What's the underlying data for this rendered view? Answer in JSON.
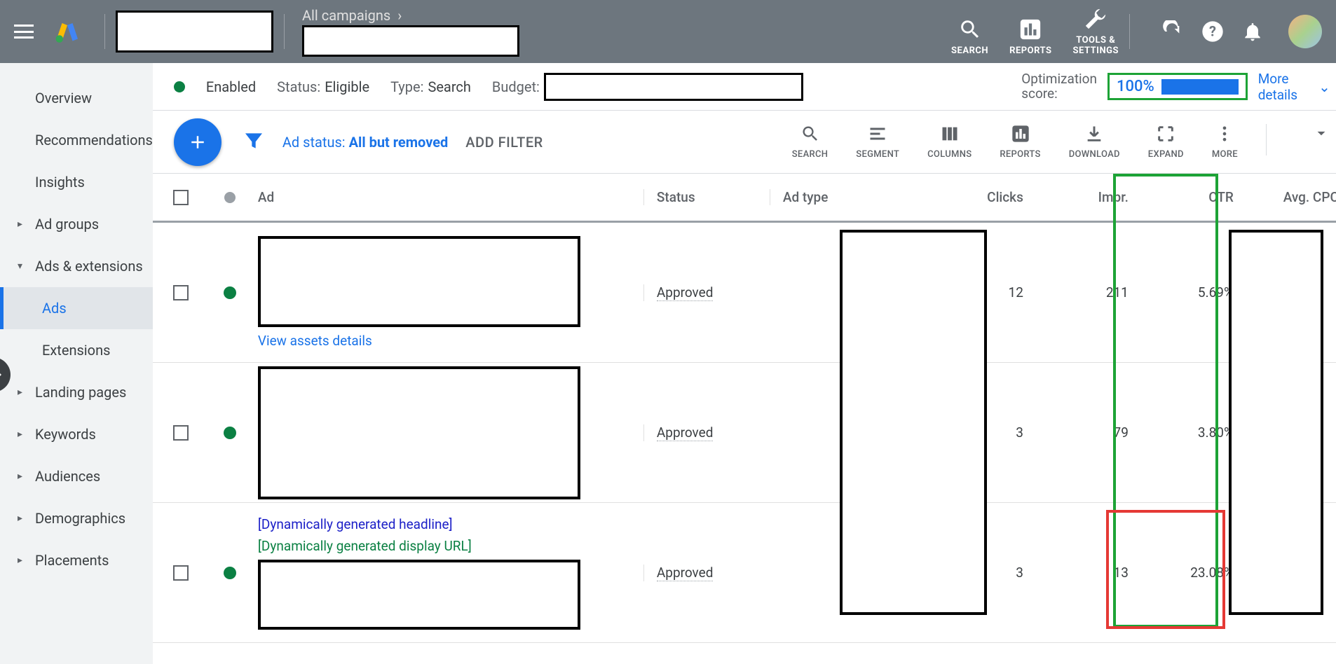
{
  "topbar": {
    "breadcrumb": "All campaigns",
    "tools": {
      "search": "SEARCH",
      "reports": "REPORTS",
      "settings": "TOOLS &\nSETTINGS"
    }
  },
  "sidebar": {
    "items": [
      {
        "label": "Overview",
        "type": "plain"
      },
      {
        "label": "Recommendations",
        "type": "plain"
      },
      {
        "label": "Insights",
        "type": "plain"
      },
      {
        "label": "Ad groups",
        "type": "expandable"
      },
      {
        "label": "Ads & extensions",
        "type": "expanded"
      },
      {
        "label": "Ads",
        "type": "sub",
        "active": true
      },
      {
        "label": "Extensions",
        "type": "sub"
      },
      {
        "label": "Landing pages",
        "type": "expandable"
      },
      {
        "label": "Keywords",
        "type": "expandable"
      },
      {
        "label": "Audiences",
        "type": "expandable"
      },
      {
        "label": "Demographics",
        "type": "expandable"
      },
      {
        "label": "Placements",
        "type": "expandable"
      }
    ]
  },
  "summary": {
    "enabled": "Enabled",
    "status_l": "Status:",
    "status_v": "Eligible",
    "type_l": "Type:",
    "type_v": "Search",
    "budget_l": "Budget:",
    "opt_l": "Optimization\nscore:",
    "opt_v": "100%",
    "more": "More\ndetails"
  },
  "toolbar": {
    "chip_k": "Ad status: ",
    "chip_v": "All but removed",
    "addfilter": "ADD FILTER",
    "mini": [
      "SEARCH",
      "SEGMENT",
      "COLUMNS",
      "REPORTS",
      "DOWNLOAD",
      "EXPAND",
      "MORE"
    ]
  },
  "table": {
    "headers": {
      "ad": "Ad",
      "status": "Status",
      "type": "Ad type",
      "clicks": "Clicks",
      "impr": "Impr.",
      "ctr": "CTR",
      "cpc": "Avg. CPC"
    },
    "rows": [
      {
        "view_assets": "View assets details",
        "status": "Approved",
        "clicks": "12",
        "impr": "211",
        "ctr": "5.69%"
      },
      {
        "status": "Approved",
        "clicks": "3",
        "impr": "79",
        "ctr": "3.80%"
      },
      {
        "dyn_head": "[Dynamically generated headline]",
        "dyn_url": "[Dynamically generated display URL]",
        "status": "Approved",
        "clicks": "3",
        "impr": "13",
        "ctr": "23.08%"
      }
    ]
  }
}
